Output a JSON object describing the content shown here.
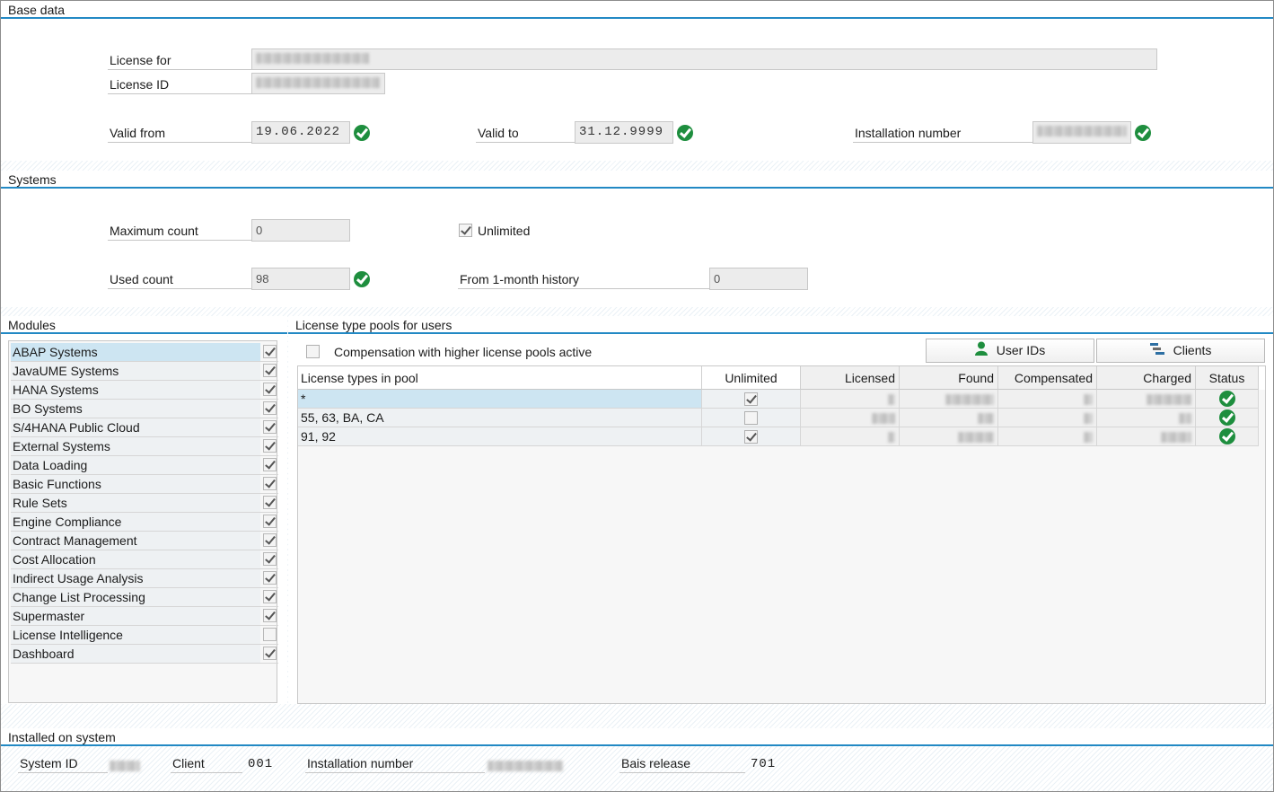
{
  "base_data": {
    "title": "Base data",
    "license_for_label": "License for",
    "license_id_label": "License ID",
    "valid_from_label": "Valid from",
    "valid_from": "19.06.2022",
    "valid_to_label": "Valid to",
    "valid_to": "31.12.9999",
    "installation_number_label": "Installation number"
  },
  "systems": {
    "title": "Systems",
    "maximum_count_label": "Maximum count",
    "maximum_count": "0",
    "unlimited_label": "Unlimited",
    "unlimited_checked": true,
    "used_count_label": "Used count",
    "used_count": "98",
    "history_label": "From 1-month history",
    "history_value": "0"
  },
  "modules": {
    "title": "Modules",
    "items": [
      {
        "name": "ABAP Systems",
        "checked": true,
        "selected": true
      },
      {
        "name": "JavaUME Systems",
        "checked": true
      },
      {
        "name": "HANA Systems",
        "checked": true
      },
      {
        "name": "BO Systems",
        "checked": true
      },
      {
        "name": "S/4HANA Public Cloud",
        "checked": true
      },
      {
        "name": "External Systems",
        "checked": true
      },
      {
        "name": "Data Loading",
        "checked": true
      },
      {
        "name": "Basic Functions",
        "checked": true
      },
      {
        "name": "Rule Sets",
        "checked": true
      },
      {
        "name": "Engine Compliance",
        "checked": true
      },
      {
        "name": "Contract Management",
        "checked": true
      },
      {
        "name": "Cost Allocation",
        "checked": true
      },
      {
        "name": "Indirect Usage Analysis",
        "checked": true
      },
      {
        "name": "Change List Processing",
        "checked": true
      },
      {
        "name": "Supermaster",
        "checked": true
      },
      {
        "name": "License Intelligence",
        "checked": false
      },
      {
        "name": "Dashboard",
        "checked": true
      }
    ]
  },
  "pools": {
    "title": "License type pools for users",
    "compensation_label": "Compensation with higher license pools active",
    "compensation_checked": false,
    "user_ids_button": "User IDs",
    "clients_button": "Clients",
    "columns": {
      "types": "License types in pool",
      "unlimited": "Unlimited",
      "licensed": "Licensed",
      "found": "Found",
      "compensated": "Compensated",
      "charged": "Charged",
      "status": "Status"
    },
    "rows": [
      {
        "types": "*",
        "unlimited": true,
        "status": "ok"
      },
      {
        "types": "55, 63, BA, CA",
        "unlimited": false,
        "status": "ok"
      },
      {
        "types": "91, 92",
        "unlimited": true,
        "status": "ok"
      }
    ]
  },
  "installed": {
    "title": "Installed on system",
    "system_id_label": "System ID",
    "client_label": "Client",
    "client": "001",
    "installation_number_label": "Installation number",
    "release_label": "Bais release",
    "release": "701"
  },
  "icons": {
    "ok": "green-check-circle-icon",
    "user": "user-icon",
    "clients": "clients-icon"
  },
  "colors": {
    "accent": "#2289c4",
    "ok": "#1e8e3e",
    "selection": "#cde5f2"
  }
}
